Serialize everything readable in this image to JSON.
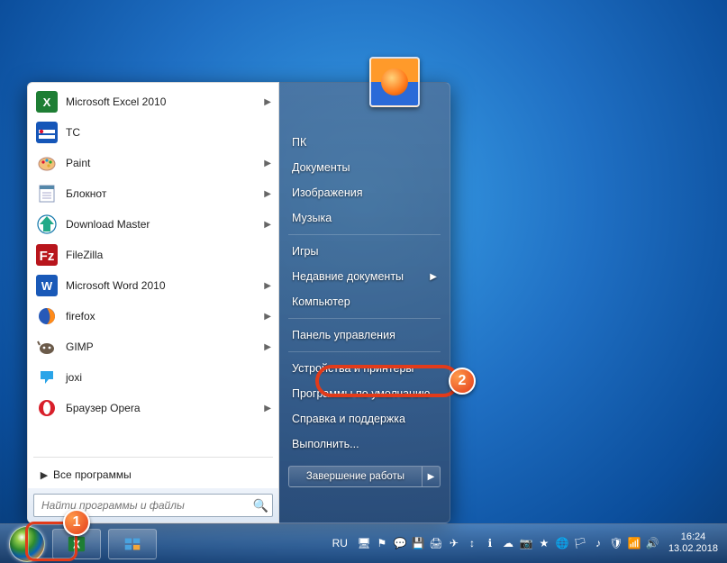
{
  "start_menu": {
    "pinned": [
      {
        "label": "Microsoft Excel 2010",
        "icon": "excel",
        "has_submenu": true
      },
      {
        "label": "TC",
        "icon": "tc",
        "has_submenu": false
      },
      {
        "label": "Paint",
        "icon": "paint",
        "has_submenu": true
      },
      {
        "label": "Блокнот",
        "icon": "notepad",
        "has_submenu": true
      },
      {
        "label": "Download Master",
        "icon": "dm",
        "has_submenu": true
      },
      {
        "label": "FileZilla",
        "icon": "filezilla",
        "has_submenu": false
      },
      {
        "label": "Microsoft Word 2010",
        "icon": "word",
        "has_submenu": true
      },
      {
        "label": "firefox",
        "icon": "firefox",
        "has_submenu": true
      },
      {
        "label": "GIMP",
        "icon": "gimp",
        "has_submenu": true
      },
      {
        "label": "joxi",
        "icon": "joxi",
        "has_submenu": false
      },
      {
        "label": "Браузер Opera",
        "icon": "opera",
        "has_submenu": true
      }
    ],
    "all_programs_label": "Все программы",
    "search_placeholder": "Найти программы и файлы",
    "right_items": [
      {
        "label": "ПК",
        "type": "item"
      },
      {
        "label": "Документы",
        "type": "item"
      },
      {
        "label": "Изображения",
        "type": "item"
      },
      {
        "label": "Музыка",
        "type": "item"
      },
      {
        "type": "sep"
      },
      {
        "label": "Игры",
        "type": "item"
      },
      {
        "label": "Недавние документы",
        "type": "item",
        "has_submenu": true
      },
      {
        "label": "Компьютер",
        "type": "item"
      },
      {
        "type": "sep"
      },
      {
        "label": "Панель управления",
        "type": "item"
      },
      {
        "type": "sep"
      },
      {
        "label": "Устройства и принтеры",
        "type": "item"
      },
      {
        "label": "Программы по умолчанию",
        "type": "item"
      },
      {
        "label": "Справка и поддержка",
        "type": "item"
      },
      {
        "label": "Выполнить...",
        "type": "item"
      }
    ],
    "shutdown_label": "Завершение работы"
  },
  "taskbar": {
    "language": "RU",
    "clock_time": "16:24",
    "clock_date": "13.02.2018",
    "tray_icons": [
      "computer",
      "flag",
      "chat",
      "disk",
      "printer",
      "telegram",
      "arrow",
      "info",
      "cloud",
      "camera",
      "star",
      "globe",
      "flag2",
      "note",
      "shield",
      "network",
      "volume"
    ]
  },
  "annotations": {
    "marker1": "1",
    "marker2": "2"
  },
  "colors": {
    "accent_red": "#e23b1a"
  }
}
